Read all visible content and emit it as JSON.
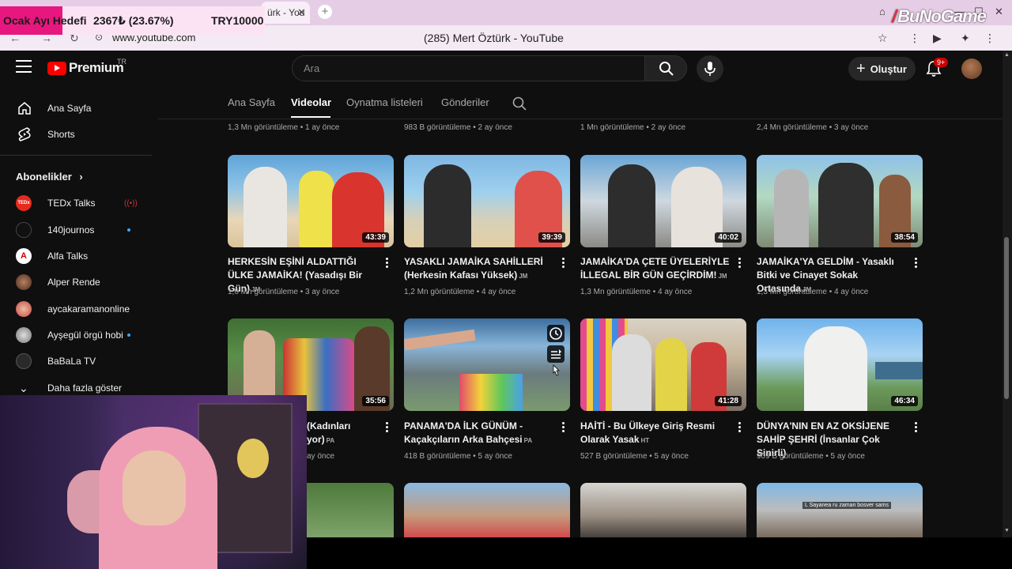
{
  "browser": {
    "tab_label": "ürk - You",
    "url": "www.youtube.com",
    "page_title": "(285) Mert Öztürk - YouTube"
  },
  "overlay": {
    "goal_label": "Ocak Ayı Hedefi",
    "goal_progress": "2367₺ (23.67%)",
    "goal_target": "TRY10000",
    "goal_fraction": 0.2367,
    "watermark": "BuNoGame",
    "goal_fill_color": "#e8177f"
  },
  "header": {
    "logo_text": "Premium",
    "country_code": "TR",
    "search_placeholder": "Ara",
    "create_label": "Oluştur",
    "notification_count": "9+"
  },
  "sidebar": {
    "main_items": [
      {
        "label": "Ana Sayfa",
        "icon": "home-icon"
      },
      {
        "label": "Shorts",
        "icon": "shorts-icon"
      }
    ],
    "subscriptions_title": "Abonelikler",
    "subscriptions": [
      {
        "label": "TEDx Talks",
        "status": "live"
      },
      {
        "label": "140journos",
        "status": "new"
      },
      {
        "label": "Alfa Talks",
        "status": ""
      },
      {
        "label": "Alper Rende",
        "status": ""
      },
      {
        "label": "aycakaramanonline",
        "status": ""
      },
      {
        "label": "Ayşegül örgü hobi",
        "status": "new"
      },
      {
        "label": "BaBaLa TV",
        "status": ""
      }
    ],
    "show_more": "Daha fazla göster"
  },
  "channel_tabs": [
    "Ana Sayfa",
    "Videolar",
    "Oynatma listeleri",
    "Gönderiler"
  ],
  "active_tab": "Videolar",
  "previous_row_meta": [
    "1,3 Mn görüntüleme • 1 ay önce",
    "983 B görüntüleme • 2 ay önce",
    "1 Mn görüntüleme • 2 ay önce",
    "2,4 Mn görüntüleme • 3 ay önce"
  ],
  "videos_row1": [
    {
      "title": "HERKESİN EŞİNİ ALDATTIĞI ÜLKE JAMAİKA! (Yasadışı Bir Gün)",
      "cc": "JM",
      "duration": "43:39",
      "meta": "1,6 Mn görüntüleme • 3 ay önce"
    },
    {
      "title": "YASAKLI JAMAİKA SAHİLLERİ (Herkesin Kafası Yüksek)",
      "cc": "JM",
      "duration": "39:39",
      "meta": "1,2 Mn görüntüleme • 4 ay önce"
    },
    {
      "title": "JAMAİKA'DA ÇETE ÜYELERİYLE İLLEGAL BİR GÜN GEÇİRDİM!",
      "cc": "JM",
      "duration": "40:02",
      "meta": "1,3 Mn görüntüleme • 4 ay önce"
    },
    {
      "title": "JAMAİKA'YA GELDİM - Yasaklı Bitki ve Cinayet Sokak Ortasında",
      "cc": "JM",
      "duration": "38:54",
      "meta": "1,3 Mn görüntüleme • 4 ay önce"
    }
  ],
  "videos_row2": [
    {
      "title_line1": "(Kadınları",
      "title_line2": "yor)",
      "cc": "PA",
      "duration": "35:56",
      "meta": "ay önce"
    },
    {
      "title": "PANAMA'DA İLK GÜNÜM - Kaçakçıların Arka Bahçesi",
      "cc": "PA",
      "duration": "",
      "meta": "418 B görüntüleme • 5 ay önce"
    },
    {
      "title": "HAİTİ - Bu Ülkeye Giriş Resmi Olarak Yasak",
      "cc": "HT",
      "duration": "41:28",
      "meta": "527 B görüntüleme • 5 ay önce"
    },
    {
      "title": "DÜNYA'NIN EN AZ OKSİJENE SAHİP ŞEHRİ (İnsanlar Çok Sinirli)",
      "cc": "",
      "duration": "46:34",
      "meta": "909 B görüntüleme • 5 ay önce"
    }
  ],
  "row3_caption": "L Sayanea ru zaman bosver sams"
}
